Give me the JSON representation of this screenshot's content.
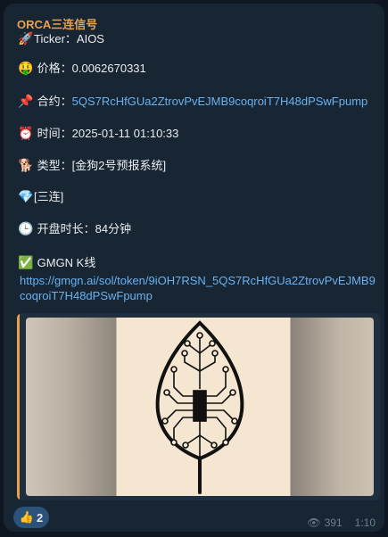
{
  "message": {
    "sender": "ORCA三连信号",
    "ticker_label": "Ticker：AIOS",
    "price_label": "价格：0.0062670331",
    "contract_prefix": "合约：",
    "contract_address": "5QS7RcHfGUa2ZtrovPvEJMB9coqroiT7H48dPSwFpump",
    "time_label": "时间：2025-01-11 01:10:33",
    "type_label": "类型：[金狗2号预报系统]",
    "combo_label": "[三连]",
    "duration_label": "开盘时长：84分钟",
    "gmgn_label": "GMGN K线",
    "gmgn_url": "https://gmgn.ai/sol/token/9iOH7RSN_5QS7RcHfGUa2ZtrovPvEJMB9coqroiT7H48dPSwFpump"
  },
  "icons": {
    "rocket": "🚀",
    "money_face": "🤑",
    "pin": "📌",
    "alarm": "⏰",
    "dog": "🐕",
    "diamond": "💎",
    "clock": "🕒",
    "check": "✅",
    "thumbs_up": "👍",
    "eye": "👁"
  },
  "reaction": {
    "count": "2"
  },
  "footer": {
    "views": "391",
    "time": "1:10"
  },
  "colors": {
    "bubble": "#182533",
    "accent": "#e8a14f",
    "link": "#6ab2f2",
    "background": "#0e1621"
  }
}
